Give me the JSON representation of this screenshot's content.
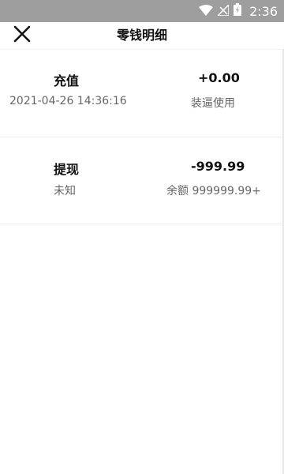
{
  "status_bar": {
    "time": "2:36",
    "icons": [
      "wifi-icon",
      "signal-icon",
      "battery-icon"
    ],
    "background": "#9e9e9e"
  },
  "header": {
    "title": "零钱明细",
    "close_icon": "close-icon"
  },
  "records": [
    {
      "type": "充值",
      "subtitle": "2021-04-26 14:36:16",
      "amount": "+0.00",
      "note": "装逼使用"
    },
    {
      "type": "提现",
      "subtitle": "未知",
      "amount": "-999.99",
      "note": "余额  999999.99+"
    }
  ]
}
